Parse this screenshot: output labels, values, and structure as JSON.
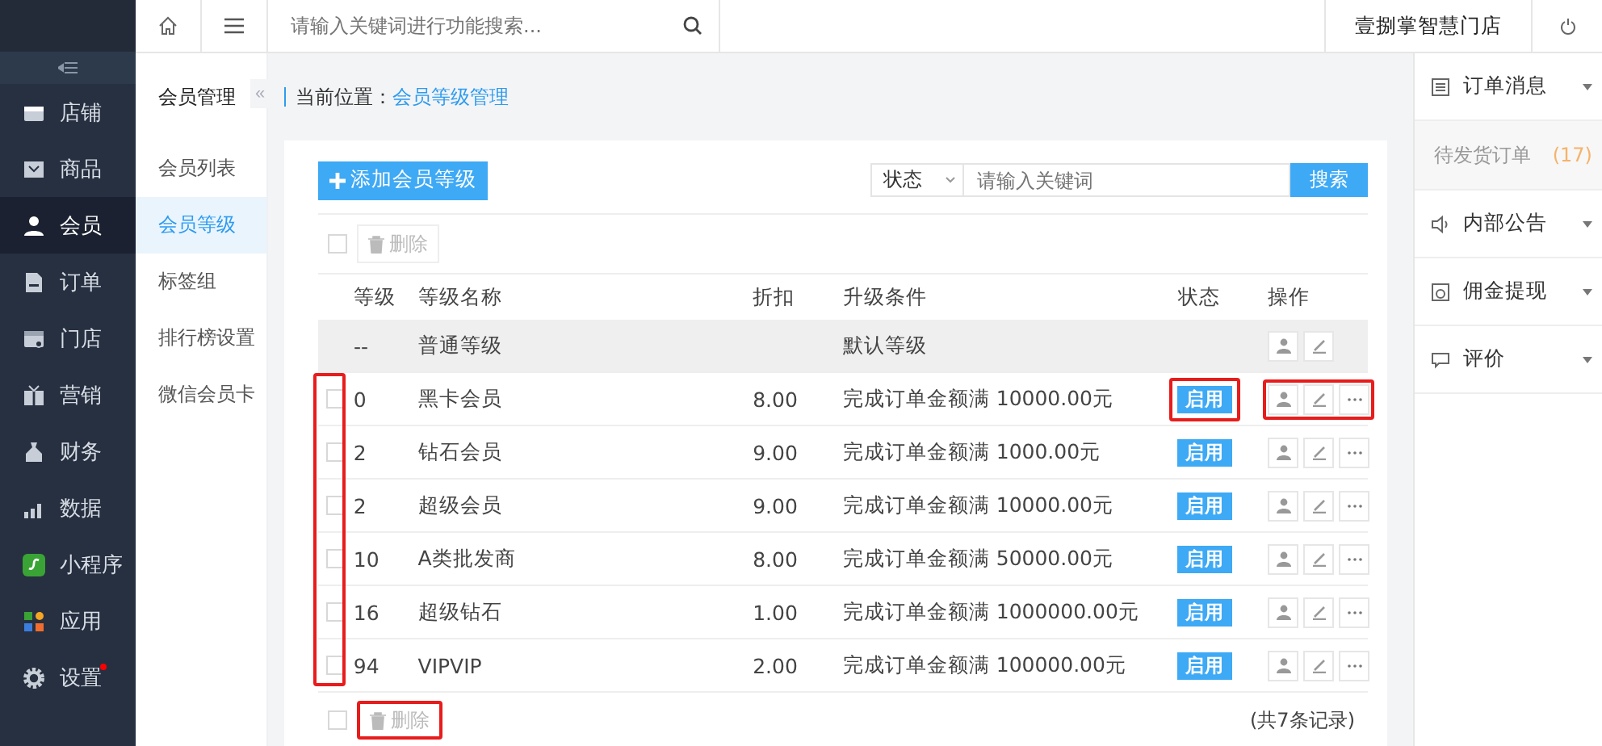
{
  "sidebar": {
    "items": [
      {
        "label": "店铺",
        "selected": false
      },
      {
        "label": "商品",
        "selected": false
      },
      {
        "label": "会员",
        "selected": true
      },
      {
        "label": "订单",
        "selected": false
      },
      {
        "label": "门店",
        "selected": false
      },
      {
        "label": "营销",
        "selected": false
      },
      {
        "label": "财务",
        "selected": false
      },
      {
        "label": "数据",
        "selected": false
      },
      {
        "label": "小程序",
        "selected": false
      },
      {
        "label": "应用",
        "selected": false
      },
      {
        "label": "设置",
        "selected": false,
        "dot": true
      }
    ]
  },
  "submenu": {
    "title": "会员管理",
    "collapse": "«",
    "items": [
      {
        "label": "会员列表",
        "selected": false
      },
      {
        "label": "会员等级",
        "selected": true
      },
      {
        "label": "标签组",
        "selected": false
      },
      {
        "label": "排行榜设置",
        "selected": false
      },
      {
        "label": "微信会员卡",
        "selected": false
      }
    ]
  },
  "topbar": {
    "search_placeholder": "请输入关键词进行功能搜索...",
    "store_name": "壹捌掌智慧门店"
  },
  "breadcrumb": {
    "label": "当前位置：",
    "current": "会员等级管理"
  },
  "toolbar": {
    "add_button": "添加会员等级",
    "status_filter": "状态",
    "keyword_placeholder": "请输入关键词",
    "search_button": "搜索"
  },
  "bulk_delete_top": {
    "select_all_checked": false,
    "label": "删除",
    "highlighted": false
  },
  "table": {
    "checkbox_column_highlighted": true,
    "columns": [
      "等级",
      "等级名称",
      "折扣",
      "升级条件",
      "状态",
      "操作"
    ],
    "rows": [
      {
        "kind": "default",
        "level": "--",
        "name": "普通等级",
        "discount": "",
        "condition": "默认等级",
        "status": "",
        "status_highlighted": false,
        "actions_highlighted": false
      },
      {
        "kind": "custom",
        "checked": false,
        "level": "0",
        "name": "黑卡会员",
        "discount": "8.00",
        "condition": "完成订单金额满 10000.00元",
        "status": "启用",
        "status_highlighted": true,
        "actions_highlighted": true
      },
      {
        "kind": "custom",
        "checked": false,
        "level": "2",
        "name": "钻石会员",
        "discount": "9.00",
        "condition": "完成订单金额满 1000.00元",
        "status": "启用",
        "status_highlighted": false,
        "actions_highlighted": false
      },
      {
        "kind": "custom",
        "checked": false,
        "level": "2",
        "name": "超级会员",
        "discount": "9.00",
        "condition": "完成订单金额满 10000.00元",
        "status": "启用",
        "status_highlighted": false,
        "actions_highlighted": false
      },
      {
        "kind": "custom",
        "checked": false,
        "level": "10",
        "name": "A类批发商",
        "discount": "8.00",
        "condition": "完成订单金额满 50000.00元",
        "status": "启用",
        "status_highlighted": false,
        "actions_highlighted": false
      },
      {
        "kind": "custom",
        "checked": false,
        "level": "16",
        "name": "超级钻石",
        "discount": "1.00",
        "condition": "完成订单金额满 1000000.00元",
        "status": "启用",
        "status_highlighted": false,
        "actions_highlighted": false
      },
      {
        "kind": "custom",
        "checked": false,
        "level": "94",
        "name": "VIPVIP",
        "discount": "2.00",
        "condition": "完成订单金额满 100000.00元",
        "status": "启用",
        "status_highlighted": false,
        "actions_highlighted": false
      }
    ]
  },
  "bulk_delete_bottom": {
    "select_all_checked": false,
    "label": "删除",
    "highlighted": true
  },
  "record_count": "(共7条记录)",
  "right_panel": {
    "sections": [
      {
        "title": "订单消息",
        "items": [
          {
            "label": "待发货订单",
            "count": "(17)"
          }
        ]
      },
      {
        "title": "内部公告"
      },
      {
        "title": "佣金提现"
      },
      {
        "title": "评价"
      }
    ]
  }
}
